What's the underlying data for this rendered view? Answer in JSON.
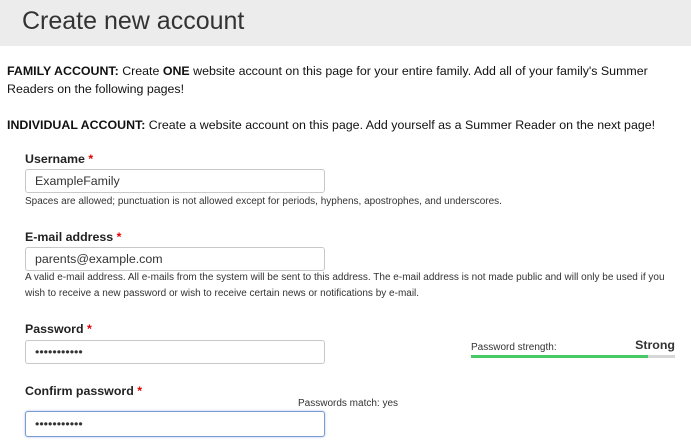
{
  "page": {
    "title": "Create new account"
  },
  "intro": {
    "family_label": "FAMILY ACCOUNT:",
    "family_text_1": " Create ",
    "family_emph": "ONE",
    "family_text_2": " website account on this page for your entire family.  Add all of your family's Summer Readers on the following pages!",
    "individual_label": "INDIVIDUAL ACCOUNT:",
    "individual_text": " Create a website account on this page.  Add yourself as a Summer Reader on the next page!"
  },
  "form": {
    "required_marker": "*",
    "username": {
      "label": "Username",
      "value": "ExampleFamily",
      "help": "Spaces are allowed; punctuation is not allowed except for periods, hyphens, apostrophes, and underscores."
    },
    "email": {
      "label": "E-mail address",
      "value": "parents@example.com",
      "help": "A valid e-mail address. All e-mails from the system will be sent to this address. The e-mail address is not made public and will only be used if you wish to receive a new password or wish to receive certain news or notifications by e-mail."
    },
    "password": {
      "label": "Password",
      "value": "•••••••••••",
      "strength_label": "Password strength:",
      "strength_value": "Strong",
      "strength_fraction": 0.87
    },
    "confirm_password": {
      "label": "Confirm password",
      "value": "•••••••••••",
      "match_text": "Passwords match: yes"
    }
  },
  "colors": {
    "strength_bar": "#47c965",
    "required": "#e00000",
    "header_background": "#ececec"
  }
}
